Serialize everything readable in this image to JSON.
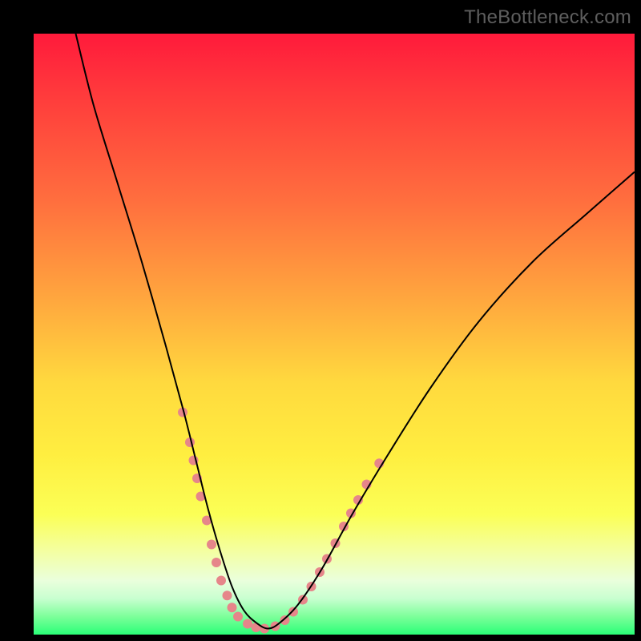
{
  "watermark": "TheBottleneck.com",
  "chart_data": {
    "type": "line",
    "title": "",
    "xlabel": "",
    "ylabel": "",
    "xlim": [
      0,
      100
    ],
    "ylim": [
      0,
      100
    ],
    "grid": false,
    "legend": false,
    "background_gradient": {
      "direction": "vertical",
      "stops": [
        {
          "pos": 0.0,
          "color": "#ff1a3b"
        },
        {
          "pos": 0.28,
          "color": "#ff6f3e"
        },
        {
          "pos": 0.58,
          "color": "#ffd93e"
        },
        {
          "pos": 0.8,
          "color": "#fbff56"
        },
        {
          "pos": 0.94,
          "color": "#c8ffd0"
        },
        {
          "pos": 1.0,
          "color": "#2aff77"
        }
      ]
    },
    "series": [
      {
        "name": "bottleneck-curve",
        "color": "#000000",
        "stroke_width": 2,
        "x": [
          7,
          10,
          14,
          18,
          22,
          25,
          27,
          29,
          31,
          33,
          35,
          37,
          39,
          41,
          44,
          48,
          53,
          59,
          66,
          74,
          83,
          92,
          100
        ],
        "y": [
          100,
          88,
          75,
          62,
          48,
          37,
          29,
          21,
          14,
          8,
          4,
          2,
          1,
          2,
          5,
          11,
          20,
          30,
          41,
          52,
          62,
          70,
          77
        ]
      }
    ],
    "markers": {
      "name": "bottleneck-dots",
      "color": "#e6868a",
      "radius": 6,
      "points": [
        {
          "x": 24.8,
          "y": 37
        },
        {
          "x": 26.0,
          "y": 32
        },
        {
          "x": 26.6,
          "y": 29
        },
        {
          "x": 27.2,
          "y": 26
        },
        {
          "x": 27.8,
          "y": 23
        },
        {
          "x": 28.8,
          "y": 19
        },
        {
          "x": 29.6,
          "y": 15
        },
        {
          "x": 30.4,
          "y": 12
        },
        {
          "x": 31.2,
          "y": 9
        },
        {
          "x": 32.2,
          "y": 6.5
        },
        {
          "x": 33.0,
          "y": 4.5
        },
        {
          "x": 34.0,
          "y": 3
        },
        {
          "x": 35.6,
          "y": 1.8
        },
        {
          "x": 37.0,
          "y": 1.2
        },
        {
          "x": 38.4,
          "y": 1.0
        },
        {
          "x": 40.2,
          "y": 1.4
        },
        {
          "x": 41.8,
          "y": 2.4
        },
        {
          "x": 43.2,
          "y": 3.8
        },
        {
          "x": 44.8,
          "y": 5.8
        },
        {
          "x": 46.2,
          "y": 8.0
        },
        {
          "x": 47.6,
          "y": 10.4
        },
        {
          "x": 48.8,
          "y": 12.6
        },
        {
          "x": 50.2,
          "y": 15.2
        },
        {
          "x": 51.6,
          "y": 18.0
        },
        {
          "x": 52.8,
          "y": 20.2
        },
        {
          "x": 54.0,
          "y": 22.4
        },
        {
          "x": 55.4,
          "y": 25.0
        },
        {
          "x": 57.5,
          "y": 28.5
        }
      ]
    }
  }
}
